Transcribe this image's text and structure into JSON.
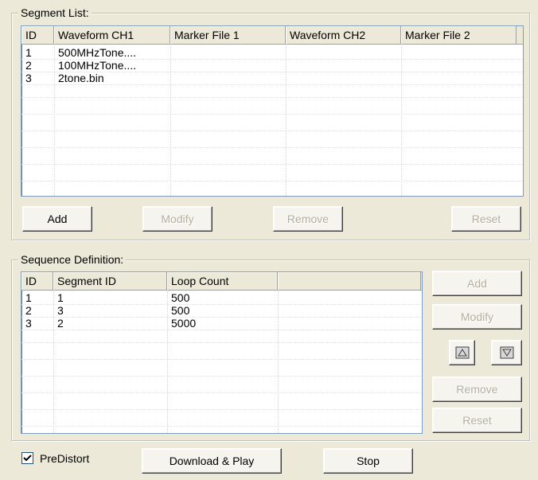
{
  "segment_list": {
    "title": "Segment List:",
    "columns": [
      "ID",
      "Waveform CH1",
      "Marker File 1",
      "Waveform CH2",
      "Marker File 2"
    ],
    "rows": [
      [
        "1",
        "500MHzTone....",
        "",
        "",
        ""
      ],
      [
        "2",
        "100MHzTone....",
        "",
        "",
        ""
      ],
      [
        "3",
        "2tone.bin",
        "",
        "",
        ""
      ]
    ],
    "buttons": {
      "add": "Add",
      "modify": "Modify",
      "remove": "Remove",
      "reset": "Reset"
    }
  },
  "sequence_definition": {
    "title": "Sequence Definition:",
    "columns": [
      "ID",
      "Segment ID",
      "Loop Count",
      ""
    ],
    "rows": [
      [
        "1",
        "1",
        "500",
        ""
      ],
      [
        "2",
        "3",
        "500",
        ""
      ],
      [
        "3",
        "2",
        "5000",
        ""
      ]
    ],
    "buttons": {
      "add": "Add",
      "modify": "Modify",
      "move_up_icon": "move-up-icon",
      "move_down_icon": "move-down-icon",
      "remove": "Remove",
      "reset": "Reset"
    }
  },
  "footer": {
    "predistort_label": "PreDistort",
    "predistort_checked": true,
    "download_play": "Download & Play",
    "stop": "Stop"
  }
}
